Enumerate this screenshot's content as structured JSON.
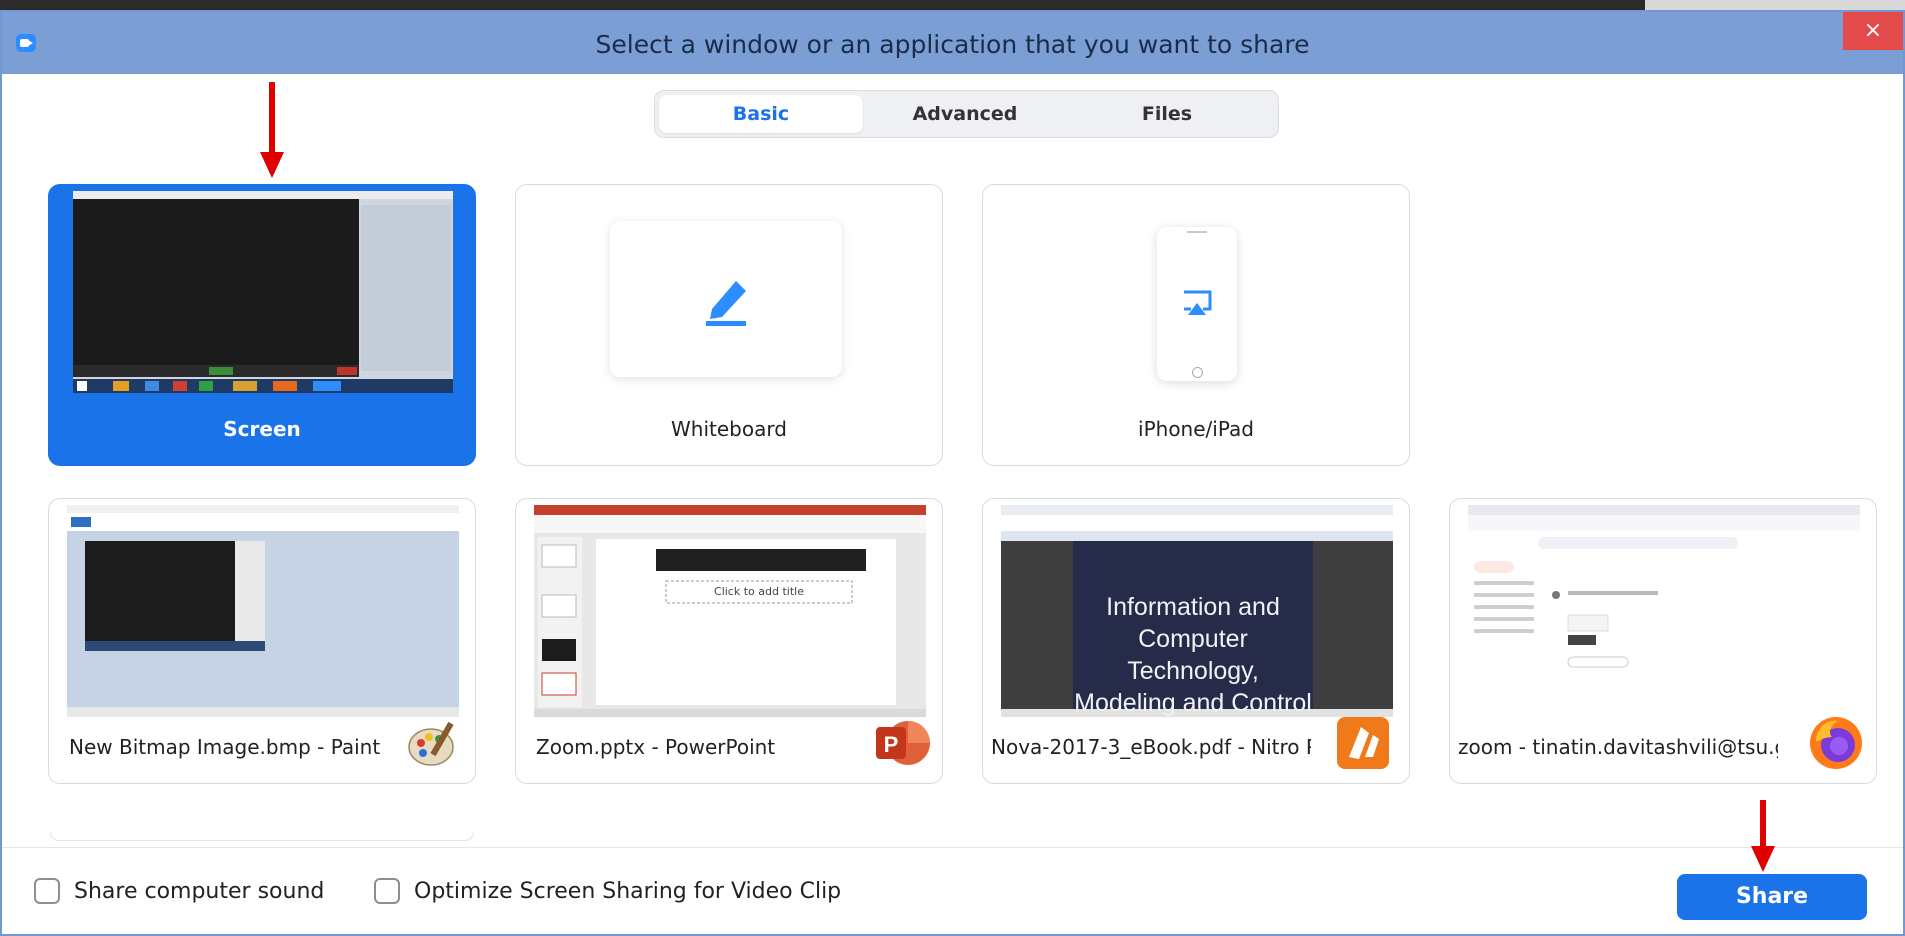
{
  "window": {
    "title": "Select a window or an application that you want to share",
    "close_label": "×"
  },
  "tabs": [
    {
      "label": "Basic",
      "active": true
    },
    {
      "label": "Advanced",
      "active": false
    },
    {
      "label": "Files",
      "active": false
    }
  ],
  "sources": [
    {
      "label": "Screen",
      "selected": true,
      "icon": "desktop-thumbnail"
    },
    {
      "label": "Whiteboard",
      "selected": false,
      "icon": "pencil-icon"
    },
    {
      "label": "iPhone/iPad",
      "selected": false,
      "icon": "airplay-icon"
    }
  ],
  "windows": [
    {
      "label": "New Bitmap Image.bmp - Paint",
      "app_icon": "paint-icon"
    },
    {
      "label": "Zoom.pptx - PowerPoint",
      "app_icon": "powerpoint-icon"
    },
    {
      "label": "Nova-2017-3_eBook.pdf - Nitro P...",
      "app_icon": "nitro-icon"
    },
    {
      "label": "zoom - tinatin.davitashvili@tsu.g...",
      "app_icon": "firefox-icon"
    }
  ],
  "thumb_text": {
    "ppt_placeholder": "Click to add title",
    "pdf_lines": [
      "Information and",
      "Computer Technology,",
      "Modeling and Control"
    ]
  },
  "options": {
    "share_sound_label": "Share computer sound",
    "share_sound_checked": false,
    "optimize_label": "Optimize Screen Sharing for Video Clip",
    "optimize_checked": false
  },
  "share_button_label": "Share",
  "colors": {
    "accent": "#1a73e8",
    "titlebar": "#7b9fd4",
    "close": "#e44a4a",
    "annotation_arrow": "#e00000"
  }
}
